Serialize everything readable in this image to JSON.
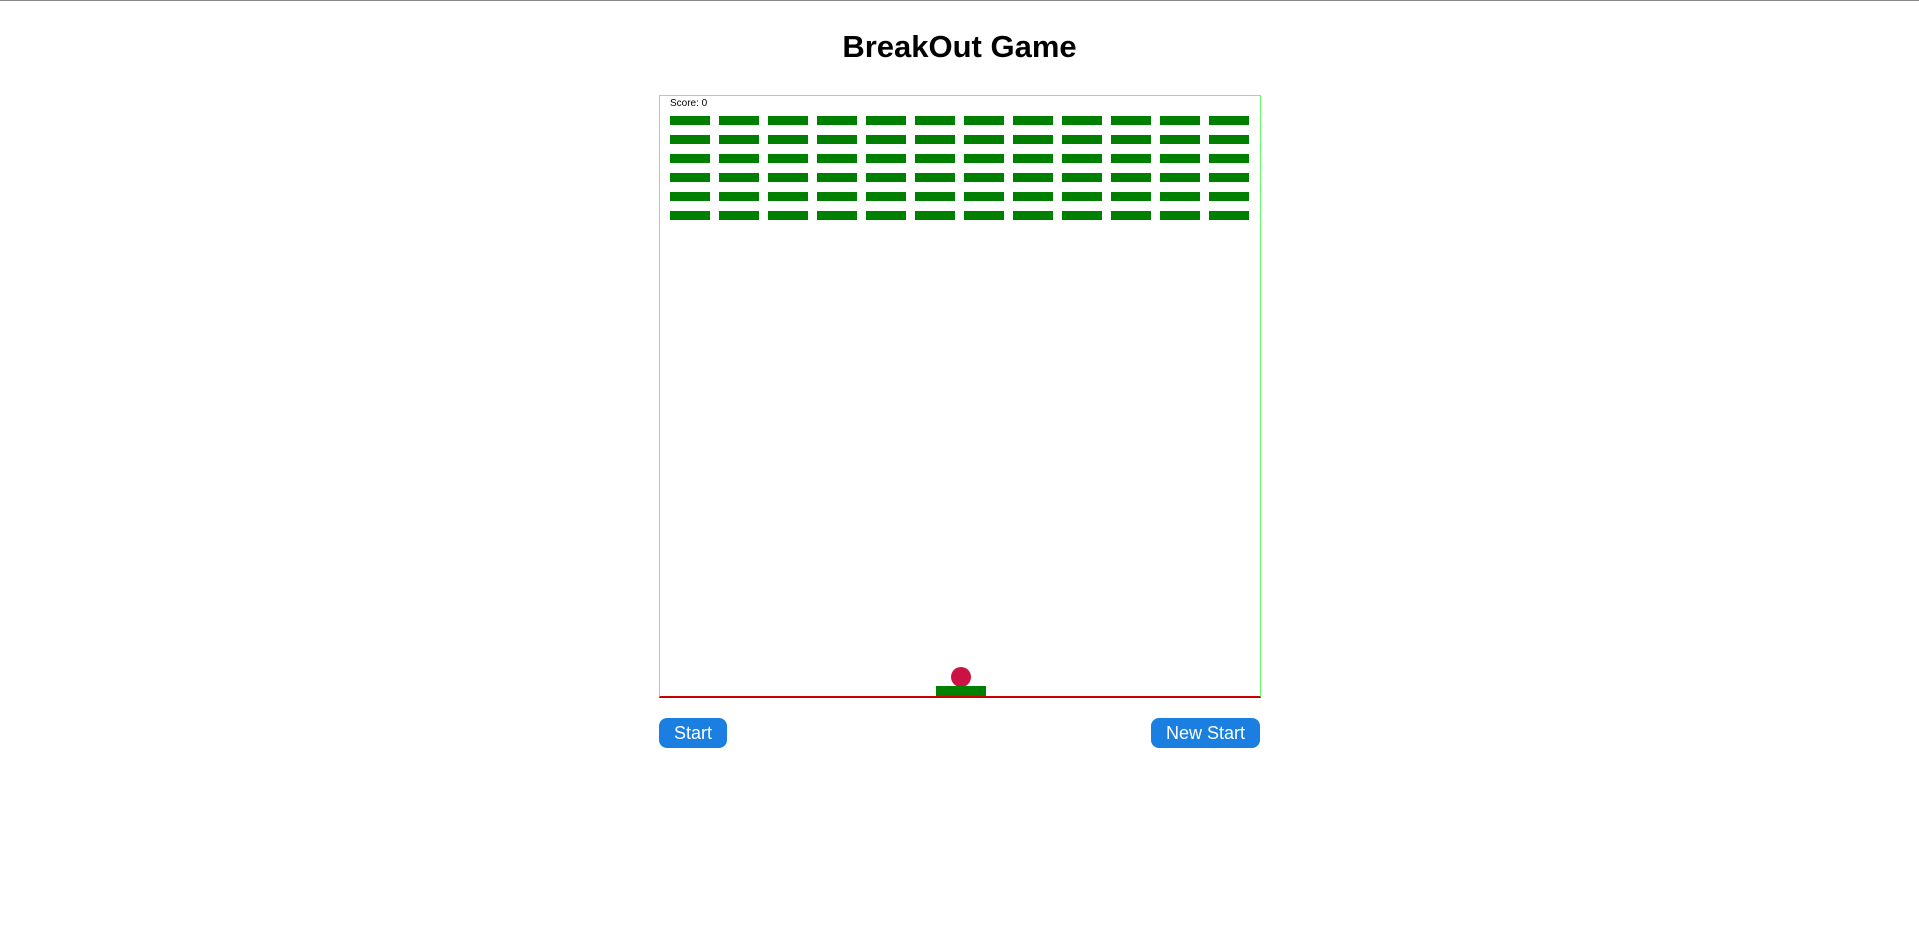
{
  "page": {
    "title": "BreakOut Game"
  },
  "game": {
    "score_label": "Score: 0",
    "score": 0,
    "brick_rows": 6,
    "brick_columns": 12,
    "colors": {
      "board_border": "#66ff66",
      "floor_line": "#cc0000",
      "brick": "#008000",
      "paddle": "#008000",
      "ball": "#cc1144"
    }
  },
  "controls": {
    "start_label": "Start",
    "new_start_label": "New Start",
    "button_color": "#1a7fe0"
  }
}
